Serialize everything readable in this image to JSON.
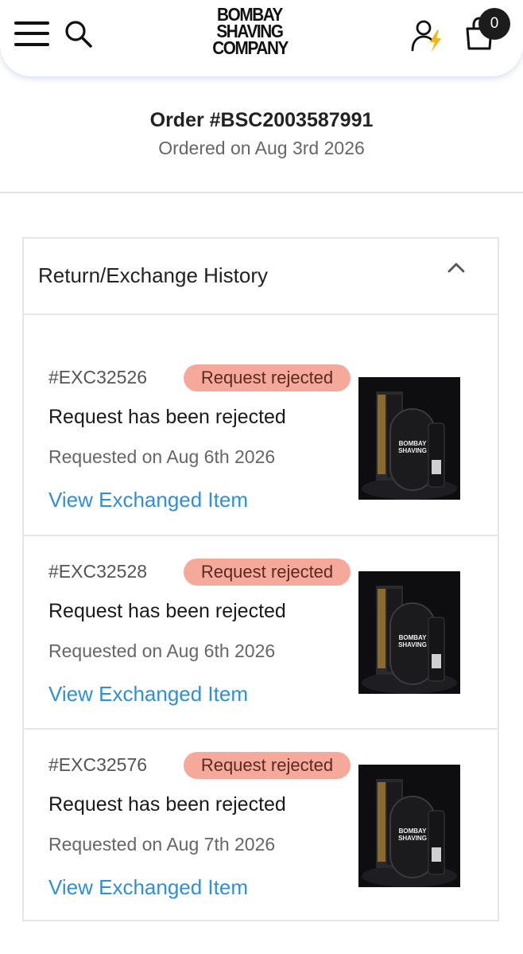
{
  "header": {
    "logo_lines": [
      "BOMBAY",
      "SHAVING",
      "COMPANY"
    ],
    "cart_count": "0"
  },
  "order": {
    "title": "Order #BSC2003587991",
    "date": "Ordered on Aug 3rd 2026"
  },
  "history": {
    "title": "Return/Exchange History",
    "requests": [
      {
        "id": "#EXC32526",
        "badge": "Request rejected",
        "status": "Request has been rejected",
        "date": "Requested on Aug 6th 2026",
        "link": "View Exchanged Item",
        "thumb": "product-kit-image"
      },
      {
        "id": "#EXC32528",
        "badge": "Request rejected",
        "status": "Request has been rejected",
        "date": "Requested on Aug 6th 2026",
        "link": "View Exchanged Item",
        "thumb": "product-kit-image"
      },
      {
        "id": "#EXC32576",
        "badge": "Request rejected",
        "status": "Request has been rejected",
        "date": "Requested on Aug 7th 2026",
        "link": "View Exchanged Item",
        "thumb": "product-kit-image"
      }
    ]
  },
  "colors": {
    "badge_bg": "#f5a99a",
    "link": "#2f8fd8",
    "accent_bolt": "#f6b21a"
  }
}
